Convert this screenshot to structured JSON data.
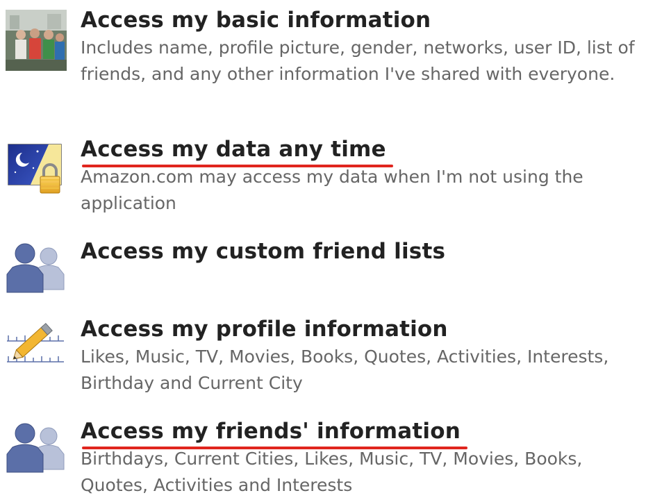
{
  "permissions": [
    {
      "icon": "profile-photo-icon",
      "title": "Access my basic information",
      "description": "Includes name, profile picture, gender, networks, user ID, list of friends, and any other information I've shared with everyone."
    },
    {
      "icon": "night-lock-icon",
      "title": "Access my data any time",
      "description": "Amazon.com may access my data when I'm not using the application"
    },
    {
      "icon": "friends-icon",
      "title": "Access my custom friend lists",
      "description": ""
    },
    {
      "icon": "pencil-ruler-icon",
      "title": "Access my profile information",
      "description": "Likes, Music, TV, Movies, Books, Quotes, Activities, Interests, Birthday and Current City"
    },
    {
      "icon": "friends-icon",
      "title": "Access my friends' information",
      "description": "Birthdays, Current Cities, Likes, Music, TV, Movies, Books, Quotes, Activities and Interests"
    }
  ],
  "colors": {
    "title": "#222222",
    "description": "#666666",
    "underline": "#e0251e",
    "friend_front": "#5b6fa8",
    "friend_back": "#b8c1d9"
  }
}
